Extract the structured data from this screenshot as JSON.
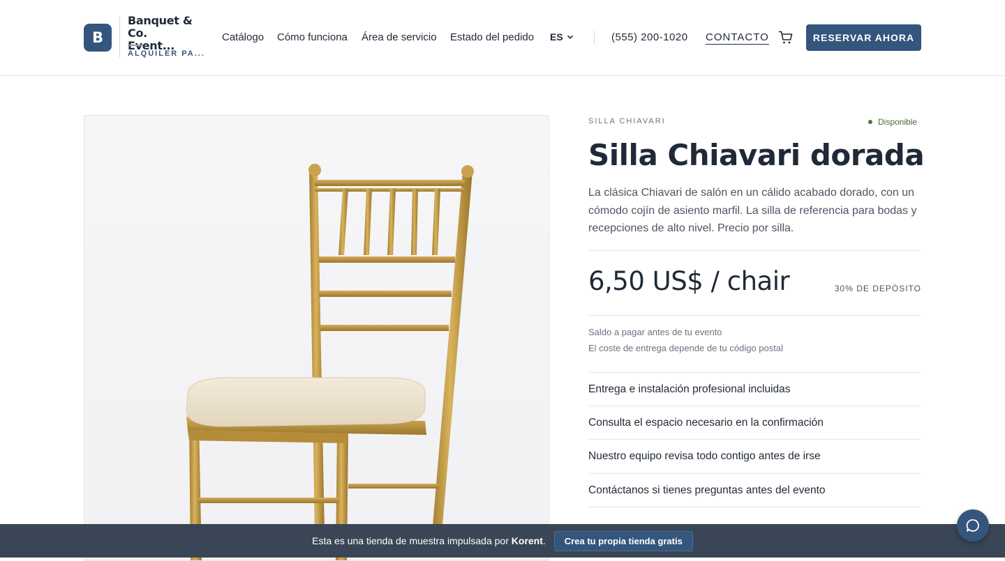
{
  "brand": {
    "logo_letter": "B",
    "name": "Banquet & Co. Event...",
    "tagline": "ALQUILER PA..."
  },
  "nav": {
    "links": [
      "Catálogo",
      "Cómo funciona",
      "Área de servicio",
      "Estado del pedido"
    ],
    "language": "ES",
    "phone": "(555) 200-1020",
    "contact": "CONTACTO",
    "cta": "RESERVAR AHORA"
  },
  "product": {
    "category": "SILLA CHIAVARI",
    "availability": "Disponible",
    "title": "Silla Chiavari dorada",
    "description": "La clásica Chiavari de salón en un cálido acabado dorado, con un cómodo cojín de asiento marfil. La silla de referencia para bodas y recepciones de alto nivel. Precio por silla.",
    "price": "6,50 US$ / chair",
    "deposit": "30% DE DEPÓSITO",
    "notes": [
      "Saldo a pagar antes de tu evento",
      "El coste de entrega depende de tu código postal"
    ],
    "features": [
      "Entrega e instalación profesional incluidas",
      "Consulta el espacio necesario en la confirmación",
      "Nuestro equipo revisa todo contigo antes de irse",
      "Contáctanos si tienes preguntas antes del evento"
    ]
  },
  "promo": {
    "text_before": "Esta es una tienda de muestra impulsada por",
    "brand": "Korent",
    "text_after": ".",
    "button": "Crea tu propia tienda gratis"
  },
  "colors": {
    "primary": "#34567c",
    "promo_bar": "#3a4556",
    "available": "#4b7a2f"
  },
  "icons": [
    "chevron-down-icon",
    "cart-icon",
    "chat-icon"
  ]
}
